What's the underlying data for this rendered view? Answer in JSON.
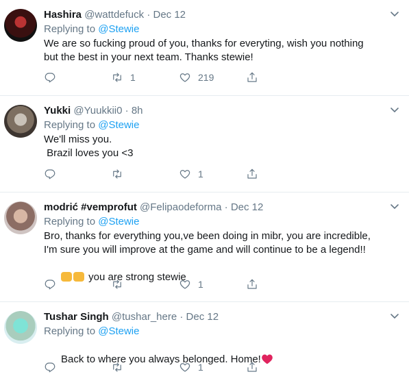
{
  "tweets": [
    {
      "name": "Hashira",
      "handle": "@wattdefuck",
      "sep": "·",
      "time": "Dec 12",
      "replying_prefix": "Replying to",
      "replying_to": "@Stewie",
      "text": "We are so fucking proud of you, thanks for everyting, wish you nothing\nbut the best in your next team. Thanks stewie!",
      "retweets": "1",
      "likes": "219"
    },
    {
      "name": "Yukki",
      "handle": "@Yuukkii0",
      "sep": "·",
      "time": "8h",
      "replying_prefix": "Replying to",
      "replying_to": "@Stewie",
      "text": "We'll miss you.\n Brazil loves you <3",
      "retweets": "",
      "likes": "1"
    },
    {
      "name": "modrić #vemprofut",
      "handle": "@Felipaodeforma",
      "sep": "·",
      "time": "Dec 12",
      "replying_prefix": "Replying to",
      "replying_to": "@Stewie",
      "text": "Bro, thanks for everything you,ve been doing in mibr, you are incredible,\nI'm sure you will improve at the game and will continue to be a legend!!",
      "text_tail": " you are strong stewie",
      "retweets": "",
      "likes": "1"
    },
    {
      "name": "Tushar Singh",
      "handle": "@tushar_here",
      "sep": "·",
      "time": "Dec 12",
      "replying_prefix": "Replying to",
      "replying_to": "@Stewie",
      "text": "Back to where you always belonged. Home!",
      "retweets": "",
      "likes": "1"
    }
  ],
  "icons": [
    "reply-icon",
    "retweet-icon",
    "like-icon",
    "share-icon",
    "chevron-down-icon",
    "red-heart-emoji",
    "fist-bump-emoji"
  ],
  "colors": {
    "text": "#14171a",
    "secondary": "#657786",
    "link": "#1da1f2",
    "divider": "#e6ecf0",
    "heart": "#e0245e"
  }
}
